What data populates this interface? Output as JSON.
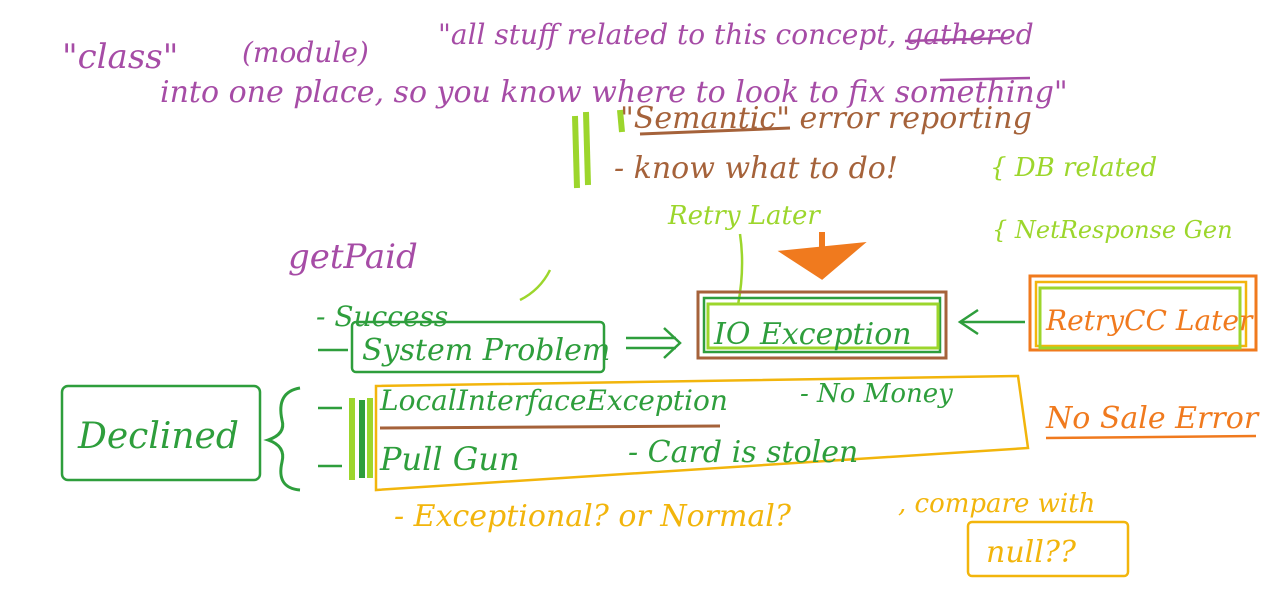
{
  "colors": {
    "purple": "#a64ca6",
    "brown": "#a5623a",
    "lime": "#9cd62c",
    "green": "#2e9e3c",
    "orange": "#f07a1e",
    "yellow": "#f2b50c"
  },
  "header": {
    "line1_class": "\"class\"",
    "line1_module": "(module)",
    "line1_rest": "\"all stuff related to this concept, gathered",
    "line2": "into one place, so you know where to look to fix something\"",
    "semantic": "\"Semantic\" error reporting",
    "know": "- know what to do!"
  },
  "labels": {
    "retry_later": "Retry Later",
    "db_related": "{ DB related",
    "response_related": "{ NetResponse Gen",
    "get_paid": "getPaid",
    "success": "- Success",
    "system_problem": "System Problem",
    "io_exception": "IO Exception",
    "retry_cc": "RetryCC Later",
    "declined": "Declined",
    "local_interface": "LocalInterfaceException",
    "no_money": "- No Money",
    "pull_gun": "Pull Gun",
    "card_stolen": "- Card is stolen",
    "no_sale": "No Sale Error",
    "exceptional": "- Exceptional? or Normal?",
    "compare": ", compare with",
    "null": "null??"
  }
}
